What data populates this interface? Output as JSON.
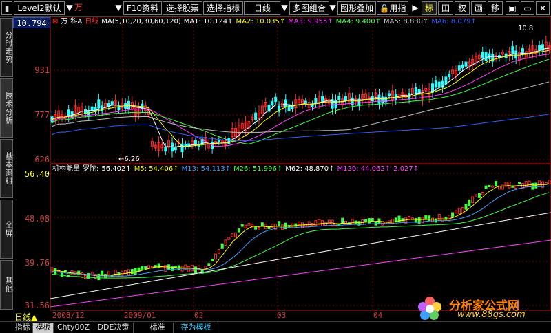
{
  "toolbar": {
    "level2": "Level2默认",
    "stock_name": "万",
    "f10": "F10资料",
    "select_stock": "选择股票",
    "select_indicator": "选择指标",
    "period": "日线",
    "multi_chart": "多图组合",
    "overlay": "图形叠加",
    "use_guide": "用指",
    "mark": "标",
    "grid": "田",
    "right": "权",
    "draw": "画",
    "move": "移"
  },
  "side_tabs": [
    "分时走势",
    "技术分析",
    "基本资料",
    "全屏",
    "其他"
  ],
  "price_readout": "10.794",
  "main_panel": {
    "stock": "万",
    "subject": "科A",
    "period_label": "日线",
    "ma_params": "MA(5,10,20,30,60,120)",
    "ma1": "MA1: 10.124↑",
    "ma2": "MA2: 10.035↑",
    "ma3": "MA3: 9.955↑",
    "ma4": "MA4: 9.400↑",
    "ma5": "MA5: 8.830↑",
    "ma6": "MA6: 8.079↑",
    "right_value": "10.8",
    "low_marker": "6.26",
    "y_ticks": [
      "931",
      "777",
      "626"
    ]
  },
  "sub_panel": {
    "name": "机构能量",
    "sub_name": "罗陀:",
    "value": "56.402↑",
    "m5": "M5: 54.406↑",
    "m13": "M13: 54.113↑",
    "m26": "M26: 51.996↑",
    "m62": "M62: 48.870↑",
    "m120": "M120: 44.062↑",
    "extra": "2.027↑",
    "y_ticks": [
      "56.40",
      "48.08",
      "39.76",
      "31.56"
    ]
  },
  "x_axis": {
    "period": "日线",
    "labels": [
      "2008/12",
      "2009/01",
      "02",
      "03",
      "04"
    ]
  },
  "bottom_tabs": [
    "指标",
    "模板",
    "Chty00Z",
    "DDE决策",
    "标准",
    "存为模板"
  ],
  "logo": {
    "title": "分析家公式网",
    "url": "www.88gs.com"
  },
  "colors": {
    "up": "#ff3030",
    "down": "#30ffff",
    "ma1": "#ffffff",
    "ma2": "#ffff00",
    "ma3": "#ff40ff",
    "ma4": "#40ff40",
    "ma5": "#c0c0c0",
    "ma6": "#3060ff"
  }
}
